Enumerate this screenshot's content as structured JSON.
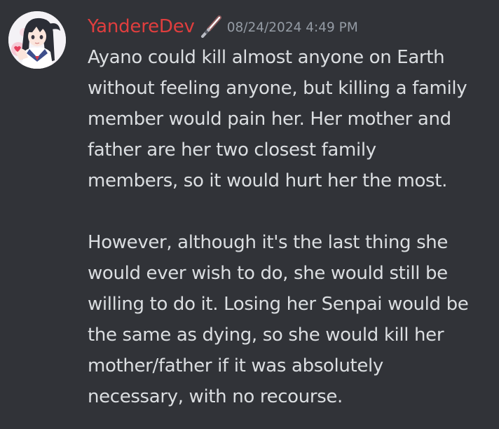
{
  "message": {
    "author": {
      "name": "YandereDev",
      "avatar_icon": "anime-character-avatar",
      "role_icon": "lightsaber-icon",
      "name_color": "#e03e3e"
    },
    "timestamp": "08/24/2024 4:49 PM",
    "paragraphs": [
      {
        "lines": [
          "Ayano could kill almost anyone on Earth",
          "without feeling anyone, but killing a family",
          "member would pain her. Her mother and",
          "father are her two closest family",
          "members, so it would hurt her the most."
        ]
      },
      {
        "lines": [
          "However, although it's the last thing she",
          "would ever wish to do, she would still be",
          "willing to do it. Losing her Senpai would be",
          "the same as dying, so she would kill her",
          "mother/father if it was absolutely",
          "necessary, with no recourse."
        ]
      }
    ]
  },
  "colors": {
    "background": "#313338",
    "text": "#dbdee1",
    "timestamp": "#949ba4"
  }
}
